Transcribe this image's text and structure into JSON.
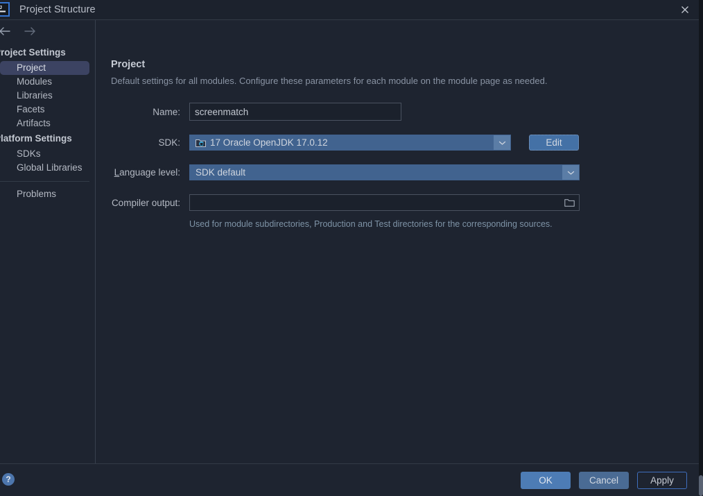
{
  "window": {
    "title": "Project Structure",
    "app_icon": "intellij-idea-icon",
    "close_icon": "close-icon"
  },
  "nav": {
    "back_icon": "arrow-left-icon",
    "forward_icon": "arrow-right-icon"
  },
  "sidebar": {
    "groups": [
      {
        "label": "Project Settings",
        "items": [
          {
            "label": "Project",
            "selected": true
          },
          {
            "label": "Modules",
            "selected": false
          },
          {
            "label": "Libraries",
            "selected": false
          },
          {
            "label": "Facets",
            "selected": false
          },
          {
            "label": "Artifacts",
            "selected": false
          }
        ]
      },
      {
        "label": "Platform Settings",
        "items": [
          {
            "label": "SDKs",
            "selected": false
          },
          {
            "label": "Global Libraries",
            "selected": false
          }
        ]
      }
    ],
    "problems_label": "Problems"
  },
  "main": {
    "title": "Project",
    "description": "Default settings for all modules. Configure these parameters for each module on the module page as needed.",
    "fields": {
      "name": {
        "label": "Name:",
        "value": "screenmatch",
        "placeholder": ""
      },
      "sdk": {
        "label": "SDK:",
        "value": "17 Oracle OpenJDK 17.0.12",
        "icon": "jdk-folder-icon",
        "dropdown_icon": "chevron-down-icon",
        "edit_label": "Edit"
      },
      "language_level": {
        "label_prefix": "",
        "label_mnemonic": "L",
        "label_rest": "anguage level:",
        "value": "SDK default",
        "dropdown_icon": "chevron-down-icon"
      },
      "compiler_output": {
        "label": "Compiler output:",
        "value": "",
        "placeholder": "",
        "browse_icon": "folder-icon",
        "hint": "Used for module subdirectories, Production and Test directories for the corresponding sources."
      }
    }
  },
  "footer": {
    "help_icon": "help-icon",
    "help_glyph": "?",
    "ok_label": "OK",
    "cancel_label": "Cancel",
    "apply_label": "Apply"
  },
  "colors": {
    "dialog_bg": "#1e2430",
    "titlebar_bg": "#1c222d",
    "accent_blue": "#4d7cb5",
    "combo_selected": "#41638f",
    "sidebar_selected": "#3c4362",
    "text_primary": "#c3c8d1",
    "text_muted": "#8a94a4",
    "hint_green": "#7e93a6"
  }
}
